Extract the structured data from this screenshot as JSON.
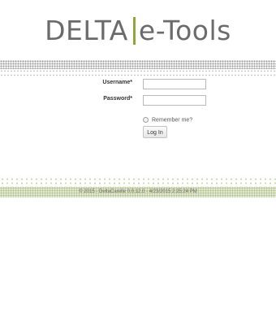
{
  "logo": {
    "left_text": "DELTA",
    "right_text": "e-Tools"
  },
  "form": {
    "username_label": "Username*",
    "username_value": "",
    "password_label": "Password*",
    "password_value": "",
    "remember_label": "Remember me?",
    "remember_checked": false,
    "login_label": "Log In"
  },
  "footer": {
    "text": "© 2015 - DeltaCarelle 0.0.12.0 - 4/23/2015 2:25:24 PM"
  },
  "colors": {
    "logo_text": "#6b6b6b",
    "logo_separator": "#8fa63a",
    "band_top": "#9a9a9a",
    "band_bottom": "#b2c28a"
  }
}
